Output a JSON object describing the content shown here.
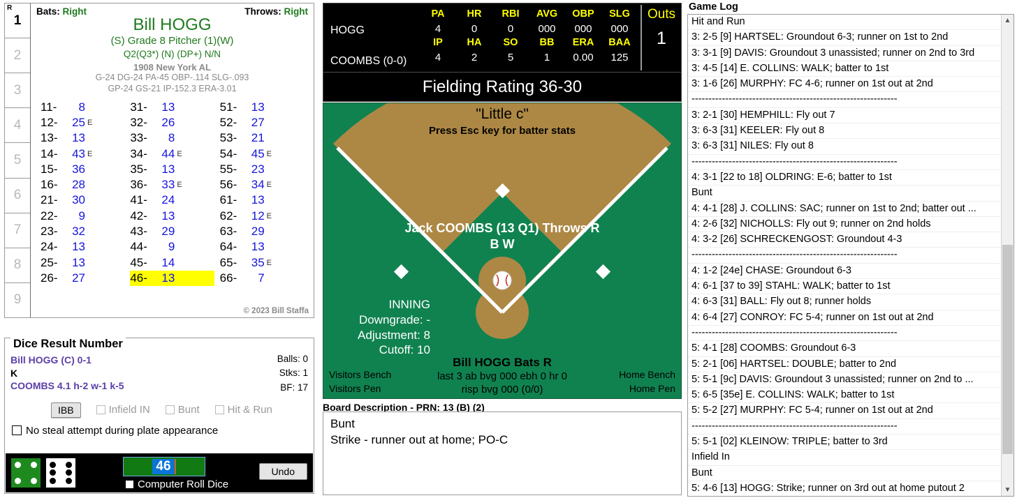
{
  "inning_column": {
    "header": "R",
    "cells": [
      "1",
      "2",
      "3",
      "4",
      "5",
      "6",
      "7",
      "8",
      "9"
    ],
    "active_index": 0
  },
  "player_card": {
    "bats_label": "Bats:",
    "bats_value": "Right",
    "throws_label": "Throws:",
    "throws_value": "Right",
    "name": "Bill HOGG",
    "role": "(S) Grade 8 Pitcher (1)(W)",
    "qualifiers": "Q2(Q3*) (N) (DP+) N/N",
    "team": "1908 New York AL",
    "stat_line_1": "G-24 DG-24 PA-45 OBP-.114 SLG-.093",
    "stat_line_2": "GP-24 GS-21 IP-152.3 ERA-3.01",
    "copyright": "© 2023 Bill Staffa",
    "highlight_key": "46-",
    "results": [
      {
        "key": "11-",
        "value": "8",
        "err": ""
      },
      {
        "key": "31-",
        "value": "13",
        "err": ""
      },
      {
        "key": "51-",
        "value": "13",
        "err": ""
      },
      {
        "key": "12-",
        "value": "25",
        "err": "E"
      },
      {
        "key": "32-",
        "value": "26",
        "err": ""
      },
      {
        "key": "52-",
        "value": "27",
        "err": ""
      },
      {
        "key": "13-",
        "value": "13",
        "err": ""
      },
      {
        "key": "33-",
        "value": "8",
        "err": ""
      },
      {
        "key": "53-",
        "value": "21",
        "err": ""
      },
      {
        "key": "14-",
        "value": "43",
        "err": "E"
      },
      {
        "key": "34-",
        "value": "44",
        "err": "E"
      },
      {
        "key": "54-",
        "value": "45",
        "err": "E"
      },
      {
        "key": "15-",
        "value": "36",
        "err": ""
      },
      {
        "key": "35-",
        "value": "13",
        "err": ""
      },
      {
        "key": "55-",
        "value": "23",
        "err": ""
      },
      {
        "key": "16-",
        "value": "28",
        "err": ""
      },
      {
        "key": "36-",
        "value": "33",
        "err": "E"
      },
      {
        "key": "56-",
        "value": "34",
        "err": "E"
      },
      {
        "key": "21-",
        "value": "30",
        "err": ""
      },
      {
        "key": "41-",
        "value": "24",
        "err": ""
      },
      {
        "key": "61-",
        "value": "13",
        "err": ""
      },
      {
        "key": "22-",
        "value": "9",
        "err": ""
      },
      {
        "key": "42-",
        "value": "13",
        "err": ""
      },
      {
        "key": "62-",
        "value": "12",
        "err": "E"
      },
      {
        "key": "23-",
        "value": "32",
        "err": ""
      },
      {
        "key": "43-",
        "value": "29",
        "err": ""
      },
      {
        "key": "63-",
        "value": "29",
        "err": ""
      },
      {
        "key": "24-",
        "value": "13",
        "err": ""
      },
      {
        "key": "44-",
        "value": "9",
        "err": ""
      },
      {
        "key": "64-",
        "value": "13",
        "err": ""
      },
      {
        "key": "25-",
        "value": "13",
        "err": ""
      },
      {
        "key": "45-",
        "value": "14",
        "err": ""
      },
      {
        "key": "65-",
        "value": "35",
        "err": "E"
      },
      {
        "key": "26-",
        "value": "27",
        "err": ""
      },
      {
        "key": "46-",
        "value": "13",
        "err": ""
      },
      {
        "key": "66-",
        "value": "7",
        "err": ""
      }
    ]
  },
  "dice_panel": {
    "title": "Dice Result Number",
    "batter_line": "Bill HOGG (C)  0-1",
    "result_code": "K",
    "pitcher_line": "COOMBS  4.1  h-2  w-1  k-5",
    "balls": "Balls: 0",
    "strikes": "Stks: 1",
    "bf": "BF: 17",
    "ibb_label": "IBB",
    "infield_in_label": "Infield IN",
    "bunt_label": "Bunt",
    "hit_run_label": "Hit & Run",
    "no_steal_label": "No steal attempt during plate appearance",
    "die1_value": 4,
    "die2_value": 6,
    "roll_number": "46",
    "computer_roll_label": "Computer Roll Dice",
    "undo_label": "Undo"
  },
  "scoreboard": {
    "batter_name": "HOGG",
    "pitcher_name": "COOMBS (0-0)",
    "batter_headers": [
      "PA",
      "HR",
      "RBI",
      "AVG",
      "OBP",
      "SLG"
    ],
    "batter_values": [
      "4",
      "0",
      "0",
      "000",
      "000",
      "000"
    ],
    "pitcher_headers": [
      "IP",
      "HA",
      "SO",
      "BB",
      "ERA",
      "BAA"
    ],
    "pitcher_values": [
      "4",
      "2",
      "5",
      "1",
      "0.00",
      "125"
    ],
    "outs_label": "Outs",
    "outs_value": "1",
    "fielding_rating": "Fielding Rating 36-30"
  },
  "field": {
    "title": "\"Little c\"",
    "subtitle": "Press Esc key for batter stats",
    "pitcher_line1": "Jack COOMBS (13 Q1) Throws R",
    "pitcher_line2": "B W",
    "inning_label": "INNING",
    "downgrade": "Downgrade: -",
    "adjustment": "Adjustment: 8",
    "cutoff": "Cutoff: 10",
    "batter_line": "Bill HOGG Bats R",
    "batter_stat1": "last 3 ab bvg 000 ebh 0 hr 0",
    "batter_stat2": "risp bvg 000 (0/0)",
    "visitors_bench": "Visitors Bench",
    "visitors_pen": "Visitors Pen",
    "home_bench": "Home Bench",
    "home_pen": "Home Pen"
  },
  "board_description": {
    "title": "Board Description",
    "subtitle": " - PRN: 13 (B) (2)",
    "line1": "Bunt",
    "line2": "Strike - runner out at home; PO-C"
  },
  "game_log": {
    "title": "Game Log",
    "entries": [
      {
        "text": "Hit and Run",
        "selected": false
      },
      {
        "text": "3: 2-5 [9] HARTSEL: Groundout 6-3; runner on 1st to 2nd",
        "selected": false
      },
      {
        "text": "3: 3-1 [9] DAVIS: Groundout 3 unassisted; runner on 2nd to 3rd",
        "selected": false
      },
      {
        "text": "3: 4-5 [14] E. COLLINS: WALK; batter to 1st",
        "selected": false
      },
      {
        "text": "3: 1-6 [26] MURPHY: FC 4-6; runner on 1st out at 2nd",
        "selected": false
      },
      {
        "text": "-------------------------------------------------------------",
        "selected": false
      },
      {
        "text": "3: 2-1 [30] HEMPHILL: Fly out 7",
        "selected": false
      },
      {
        "text": "3: 6-3 [31] KEELER: Fly out 8",
        "selected": false
      },
      {
        "text": "3: 6-3 [31] NILES: Fly out 8",
        "selected": false
      },
      {
        "text": "-------------------------------------------------------------",
        "selected": false
      },
      {
        "text": "4: 3-1 [22 to 18] OLDRING: E-6; batter to 1st",
        "selected": false
      },
      {
        "text": "Bunt",
        "selected": false
      },
      {
        "text": "4: 4-1 [28] J. COLLINS: SAC; runner on 1st to 2nd; batter out ...",
        "selected": false
      },
      {
        "text": "4: 2-6 [32] NICHOLLS: Fly out 9; runner on 2nd holds",
        "selected": false
      },
      {
        "text": "4: 3-2 [26] SCHRECKENGOST: Groundout 4-3",
        "selected": false
      },
      {
        "text": "-------------------------------------------------------------",
        "selected": false
      },
      {
        "text": "4: 1-2 [24e] CHASE: Groundout 6-3",
        "selected": false
      },
      {
        "text": "4: 6-1 [37 to 39] STAHL: WALK; batter to 1st",
        "selected": false
      },
      {
        "text": "4: 6-3 [31] BALL: Fly out 8; runner holds",
        "selected": false
      },
      {
        "text": "4: 6-4 [27] CONROY: FC 5-4; runner on 1st out at 2nd",
        "selected": false
      },
      {
        "text": "-------------------------------------------------------------",
        "selected": false
      },
      {
        "text": "5: 4-1 [28] COOMBS: Groundout 6-3",
        "selected": false
      },
      {
        "text": "5: 2-1 [06] HARTSEL: DOUBLE; batter to 2nd",
        "selected": false
      },
      {
        "text": "5: 5-1 [9c] DAVIS: Groundout 3 unassisted; runner on 2nd to ...",
        "selected": false
      },
      {
        "text": "5: 6-5 [35e] E. COLLINS: WALK; batter to 1st",
        "selected": false
      },
      {
        "text": "5: 5-2 [27] MURPHY: FC 5-4; runner on 1st out at 2nd",
        "selected": false
      },
      {
        "text": "-------------------------------------------------------------",
        "selected": false
      },
      {
        "text": "5: 5-1 [02] KLEINOW: TRIPLE; batter to 3rd",
        "selected": false
      },
      {
        "text": "Infield In",
        "selected": false
      },
      {
        "text": "Bunt",
        "selected": false
      },
      {
        "text": "5: 4-6 [13] HOGG: Strike; runner on 3rd out at home putout 2",
        "selected": false
      }
    ]
  },
  "colors": {
    "grass": "#108250",
    "dirt": "#AD8844",
    "accent_green": "#1e7a1e",
    "value_blue": "#1414dd",
    "highlight_yellow": "#ffff00",
    "scoreboard_header": "#ffff00",
    "purple_text": "#5b3fa8"
  }
}
